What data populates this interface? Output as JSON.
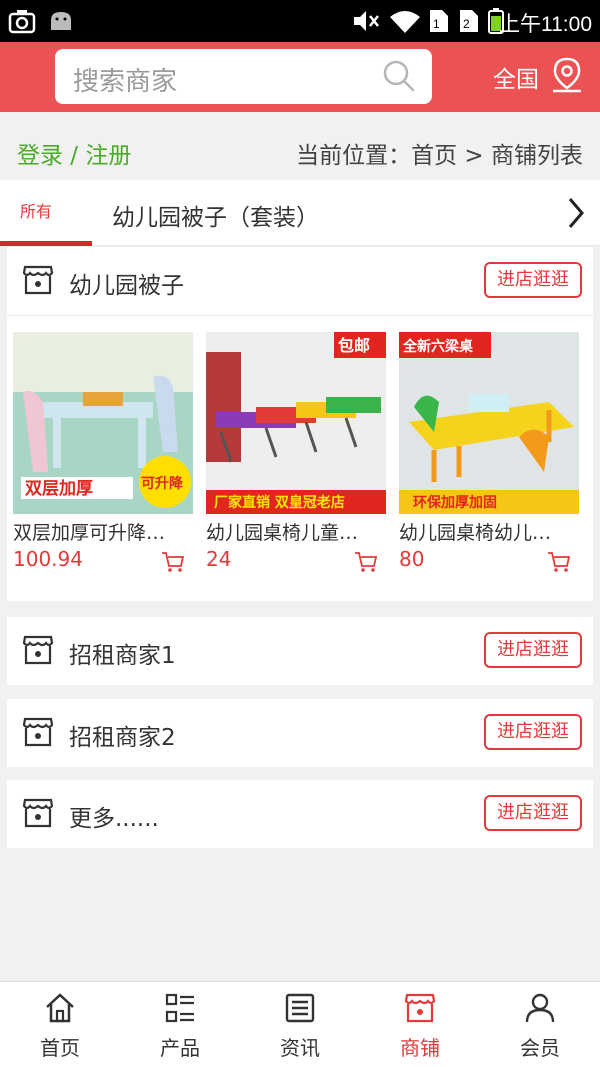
{
  "status_bar": {
    "time": "上午11:00"
  },
  "header": {
    "search_placeholder": "搜索商家",
    "region": "全国"
  },
  "location_row": {
    "login": "登录 / 注册",
    "breadcrumb": "当前位置：首页 > 商铺列表"
  },
  "tabs": [
    {
      "label": "所有",
      "active": true
    },
    {
      "label": "幼儿园被子（套装）",
      "active": false
    }
  ],
  "shops": [
    {
      "name": "幼儿园被子",
      "button": "进店逛逛",
      "products": [
        {
          "title": "双层加厚可升降…",
          "price": "100.94",
          "image_text": "双层加厚",
          "image_badge": "可升降"
        },
        {
          "title": "幼儿园桌椅儿童…",
          "price": "24",
          "image_text": "厂家直销 双皇冠老店",
          "image_badge": "包邮"
        },
        {
          "title": "幼儿园桌椅幼儿…",
          "price": "80",
          "image_text": "环保加厚加固",
          "image_badge": "全新六梁桌"
        }
      ]
    },
    {
      "name": "招租商家1",
      "button": "进店逛逛"
    },
    {
      "name": "招租商家2",
      "button": "进店逛逛"
    },
    {
      "name": "更多......",
      "button": "进店逛逛"
    }
  ],
  "bottom_nav": [
    {
      "label": "首页",
      "icon": "home-icon",
      "active": false
    },
    {
      "label": "产品",
      "icon": "list-icon",
      "active": false
    },
    {
      "label": "资讯",
      "icon": "news-icon",
      "active": false
    },
    {
      "label": "商铺",
      "icon": "store-icon",
      "active": true
    },
    {
      "label": "会员",
      "icon": "user-icon",
      "active": false
    }
  ],
  "colors": {
    "brand": "#eb5253",
    "accent": "#e23a3a",
    "login": "#4caa2a"
  }
}
